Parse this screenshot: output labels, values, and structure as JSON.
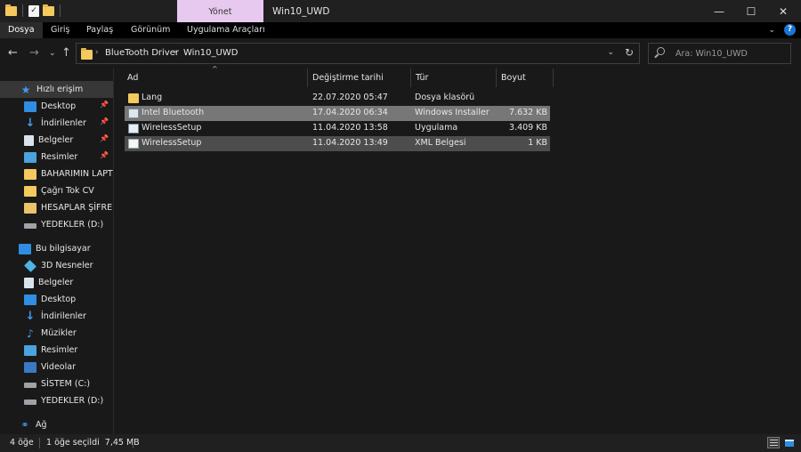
{
  "window": {
    "title": "Win10_UWD",
    "manage_tab": "Yönet"
  },
  "ribbon": {
    "tabs": [
      "Dosya",
      "Giriş",
      "Paylaş",
      "Görünüm",
      "Uygulama Araçları"
    ]
  },
  "address": {
    "crumbs": [
      "BlueTooth Driver",
      "Win10_UWD"
    ]
  },
  "search": {
    "placeholder": "Ara: Win10_UWD"
  },
  "sidebar": {
    "quick_access": "Hızlı erişim",
    "quick_items": [
      "Desktop",
      "İndirilenler",
      "Belgeler",
      "Resimler",
      "BAHARIMIN LAPTOP",
      "Çağrı Tok CV",
      "HESAPLAR ŞİFRELER",
      "YEDEKLER (D:)"
    ],
    "this_pc": "Bu bilgisayar",
    "pc_items": [
      "3D Nesneler",
      "Belgeler",
      "Desktop",
      "İndirilenler",
      "Müzikler",
      "Resimler",
      "Videolar",
      "SİSTEM (C:)",
      "YEDEKLER (D:)"
    ],
    "network": "Ağ"
  },
  "columns": {
    "name": "Ad",
    "modified": "Değiştirme tarihi",
    "type": "Tür",
    "size": "Boyut"
  },
  "files": [
    {
      "name": "Lang",
      "modified": "22.07.2020 05:47",
      "type": "Dosya klasörü",
      "size": ""
    },
    {
      "name": "Intel Bluetooth",
      "modified": "17.04.2020 06:34",
      "type": "Windows Installer ...",
      "size": "7.632 KB"
    },
    {
      "name": "WirelessSetup",
      "modified": "11.04.2020 13:58",
      "type": "Uygulama",
      "size": "3.409 KB"
    },
    {
      "name": "WirelessSetup",
      "modified": "11.04.2020 13:49",
      "type": "XML Belgesi",
      "size": "1 KB"
    }
  ],
  "status": {
    "count": "4 öğe",
    "selected": "1 öğe seçildi  7,45 MB"
  }
}
